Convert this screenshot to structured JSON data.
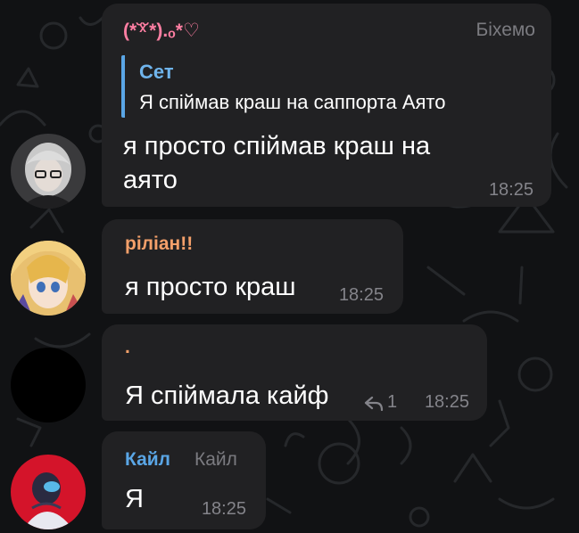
{
  "messages": [
    {
      "sender": "(*˘ͯ˘*).ₒ*♡",
      "sender_tag": "Біхемо",
      "sender_color": "#ff7fa3",
      "reply_to": {
        "name": "Сет",
        "text": "Я спіймав краш на саппорта Аято"
      },
      "text_lines": [
        "я просто спіймав краш на",
        "аято"
      ],
      "time": "18:25",
      "avatar": "avatar-light-hair"
    },
    {
      "sender": "ріліан!!",
      "sender_color": "#f4a06a",
      "text": "я просто краш",
      "time": "18:25",
      "avatar": "avatar-anime-girl"
    },
    {
      "sender": ".",
      "sender_color": "#f4a06a",
      "text": "Я спіймала кайф",
      "reply_count": "1",
      "time": "18:25",
      "avatar": "avatar-dark"
    },
    {
      "sender": "Кайл",
      "sender_tag": "Кайл",
      "sender_color": "#5aa6e6",
      "text": "Я",
      "time": "18:25",
      "avatar": "avatar-red-photo"
    }
  ],
  "colors": {
    "background": "#111214",
    "bubble": "#212123",
    "reply_accent": "#5aa6e6",
    "time": "#84848a"
  }
}
